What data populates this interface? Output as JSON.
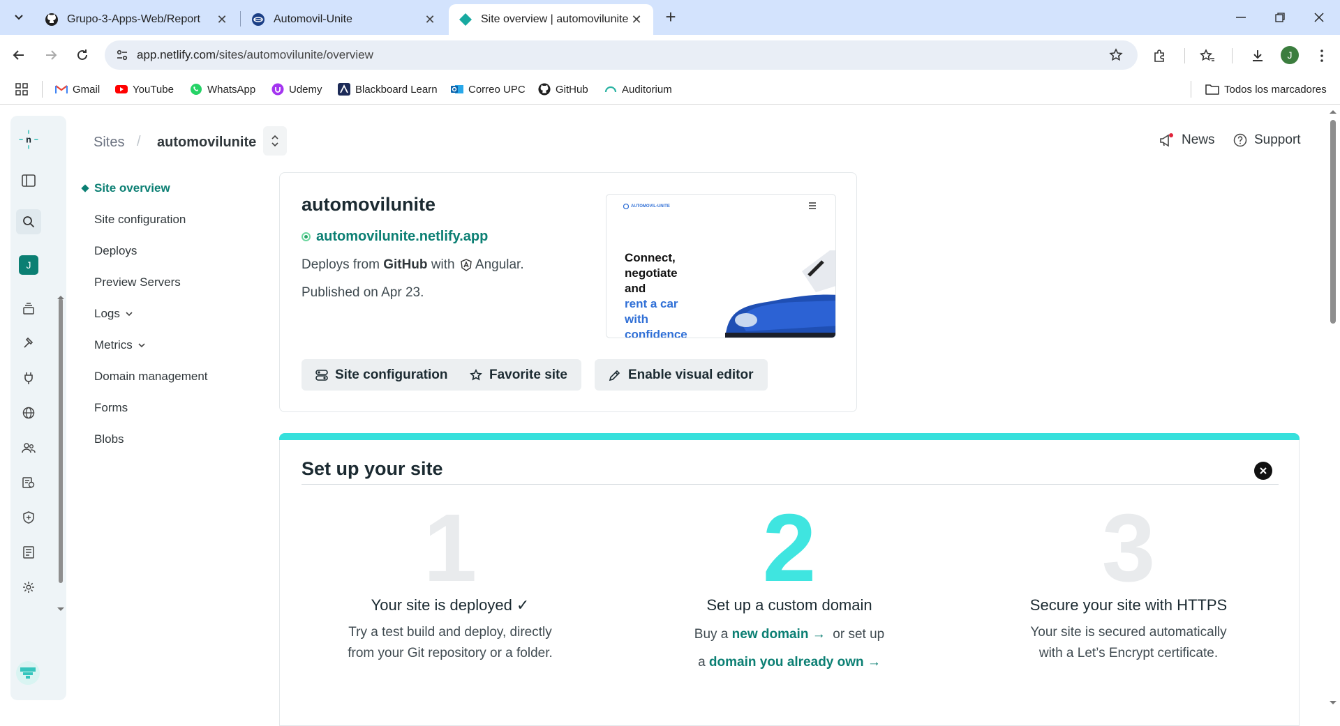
{
  "browser": {
    "tabs": [
      {
        "title": "Grupo-3-Apps-Web/Report",
        "icon": "github-icon"
      },
      {
        "title": "Automovil-Unite",
        "icon": "angular-site-icon"
      },
      {
        "title": "Site overview | automovilunite |",
        "icon": "netlify-icon"
      }
    ],
    "url_host": "app.netlify.com",
    "url_path": "/sites/automovilunite/overview",
    "profile_initial": "J",
    "bookmarks": [
      {
        "label": "Gmail",
        "icon": "gmail-icon"
      },
      {
        "label": "YouTube",
        "icon": "youtube-icon"
      },
      {
        "label": "WhatsApp",
        "icon": "whatsapp-icon"
      },
      {
        "label": "Udemy",
        "icon": "udemy-icon"
      },
      {
        "label": "Blackboard Learn",
        "icon": "blackboard-icon"
      },
      {
        "label": "Correo UPC",
        "icon": "outlook-icon"
      },
      {
        "label": "GitHub",
        "icon": "github-icon"
      },
      {
        "label": "Auditorium",
        "icon": "auditorium-icon"
      }
    ],
    "all_bookmarks": "Todos los marcadores"
  },
  "rail": {
    "avatar_initial": "J"
  },
  "header": {
    "sites": "Sites",
    "separator": "/",
    "site_name": "automovilunite",
    "news": "News",
    "support": "Support"
  },
  "sidenav": [
    {
      "label": "Site overview",
      "active": true
    },
    {
      "label": "Site configuration"
    },
    {
      "label": "Deploys"
    },
    {
      "label": "Preview Servers"
    },
    {
      "label": "Logs",
      "chevron": true
    },
    {
      "label": "Metrics",
      "chevron": true
    },
    {
      "label": "Domain management"
    },
    {
      "label": "Forms"
    },
    {
      "label": "Blobs"
    }
  ],
  "site_card": {
    "title": "automovilunite",
    "url": "automovilunite.netlify.app",
    "deploys_prefix": "Deploys from",
    "deploys_source": "GitHub",
    "deploys_with": "with",
    "framework": "Angular.",
    "published": "Published on Apr 23.",
    "thumbnail": {
      "logo_text": "AUTOMOVIL-UNITE",
      "headline_dark": "Connect, negotiate and",
      "headline_blue": "rent a car with confidence"
    },
    "buttons": {
      "config": "Site configuration",
      "favorite": "Favorite site",
      "visual_editor": "Enable visual editor"
    }
  },
  "setup": {
    "title": "Set up your site",
    "steps": [
      {
        "num": "1",
        "title": "Your site is deployed ✓",
        "text1": "Try a test build and deploy, directly",
        "text2": "from your Git repository or a folder."
      },
      {
        "num": "2",
        "title": "Set up a custom domain",
        "pre": "Buy a",
        "link1": "new domain →",
        "mid": "or set up",
        "pre2": "a",
        "link2": "domain you already own →"
      },
      {
        "num": "3",
        "title": "Secure your site with HTTPS",
        "text1": "Your site is secured automatically",
        "text2": "with a Let’s Encrypt certificate."
      }
    ]
  },
  "colors": {
    "accent": "#0b7f73",
    "setup_bar": "#36e0dc",
    "tabstrip": "#d3e3fd"
  }
}
